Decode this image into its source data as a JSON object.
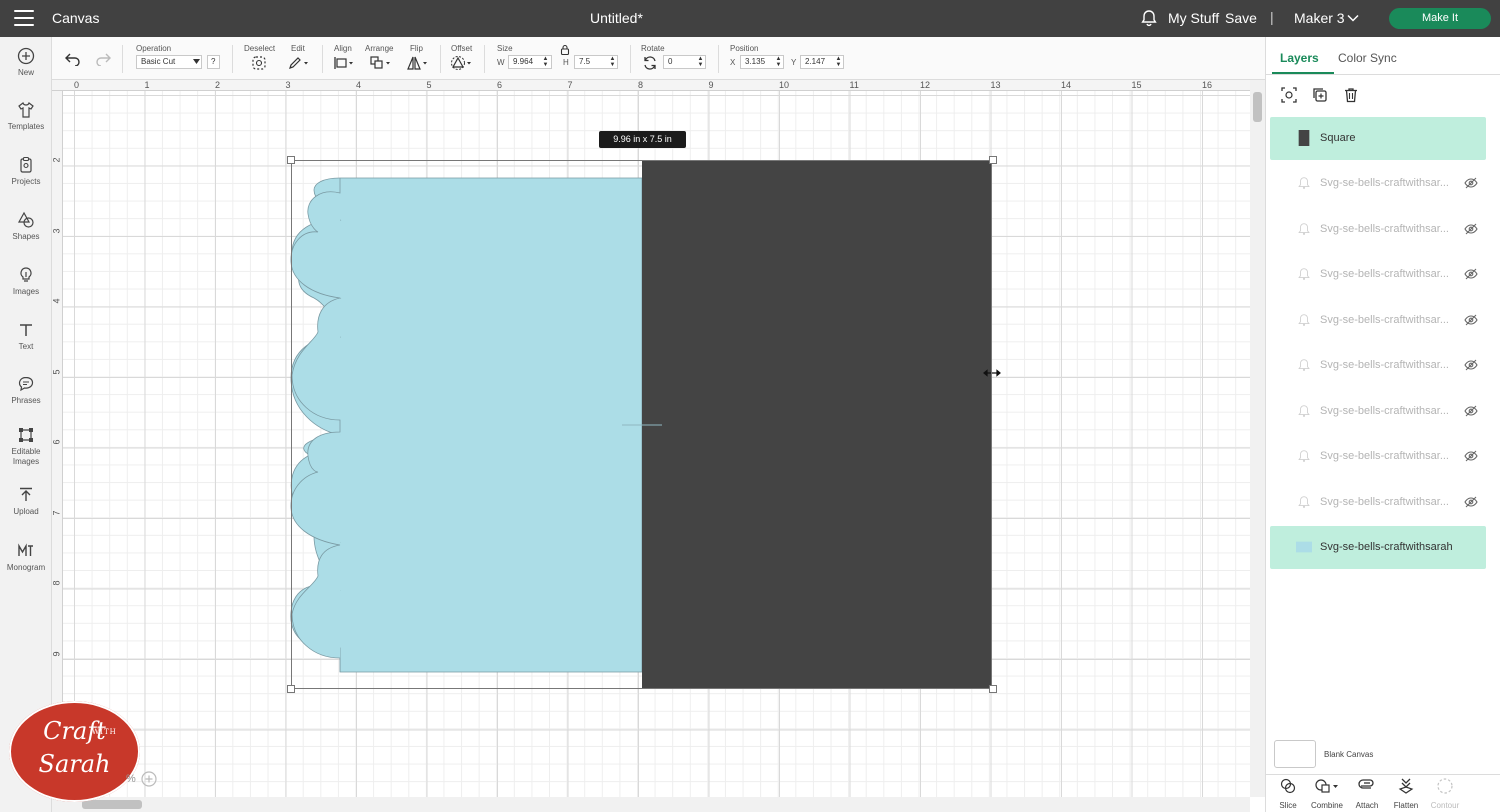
{
  "header": {
    "app_name": "Canvas",
    "doc_title": "Untitled*",
    "my_stuff": "My Stuff",
    "save": "Save",
    "separator": "|",
    "machine": "Maker 3",
    "make_it": "Make It"
  },
  "leftbar": {
    "items": [
      {
        "label": "New",
        "icon": "plus-circle-icon"
      },
      {
        "label": "Templates",
        "icon": "shirt-icon"
      },
      {
        "label": "Projects",
        "icon": "projects-icon"
      },
      {
        "label": "Shapes",
        "icon": "shapes-icon"
      },
      {
        "label": "Images",
        "icon": "lightbulb-icon"
      },
      {
        "label": "Text",
        "icon": "text-icon"
      },
      {
        "label": "Phrases",
        "icon": "speech-bubble-icon"
      },
      {
        "label": "Editable Images",
        "icon": "editable-images-icon"
      },
      {
        "label": "Upload",
        "icon": "upload-icon"
      },
      {
        "label": "Monogram",
        "icon": "monogram-icon"
      }
    ]
  },
  "toolbar": {
    "operation_label": "Operation",
    "operation_value": "Basic Cut",
    "help": "?",
    "deselect_label": "Deselect",
    "edit_label": "Edit",
    "align_label": "Align",
    "arrange_label": "Arrange",
    "flip_label": "Flip",
    "offset_label": "Offset",
    "size_label": "Size",
    "w_label": "W",
    "w_value": "9.964",
    "h_label": "H",
    "h_value": "7.5",
    "rotate_label": "Rotate",
    "rotate_value": "0",
    "position_label": "Position",
    "x_label": "X",
    "x_value": "3.135",
    "y_label": "Y",
    "y_value": "2.147"
  },
  "canvas": {
    "ruler_x": [
      "0",
      "1",
      "2",
      "3",
      "4",
      "5",
      "6",
      "7",
      "8",
      "9",
      "10",
      "11",
      "12",
      "13",
      "14",
      "15",
      "16"
    ],
    "ruler_y": [
      "2",
      "3",
      "4",
      "5",
      "6",
      "7",
      "8",
      "9"
    ],
    "size_tooltip": "9.96  in x 7.5  in",
    "design_colors": {
      "card": "#acdde7",
      "square": "#444444"
    }
  },
  "watermark": {
    "line1": "Craft",
    "with": "WITH",
    "line2": "Sarah"
  },
  "zoom": {
    "label": "%"
  },
  "rightpanel": {
    "tabs": {
      "layers": "Layers",
      "color_sync": "Color Sync"
    },
    "layers": [
      {
        "name": "Square",
        "selected": true,
        "hidden": false,
        "color": "#444444"
      },
      {
        "name": "Svg-se-bells-craftwithsar...",
        "selected": false,
        "hidden": true
      },
      {
        "name": "Svg-se-bells-craftwithsar...",
        "selected": false,
        "hidden": true
      },
      {
        "name": "Svg-se-bells-craftwithsar...",
        "selected": false,
        "hidden": true
      },
      {
        "name": "Svg-se-bells-craftwithsar...",
        "selected": false,
        "hidden": true
      },
      {
        "name": "Svg-se-bells-craftwithsar...",
        "selected": false,
        "hidden": true
      },
      {
        "name": "Svg-se-bells-craftwithsar...",
        "selected": false,
        "hidden": true
      },
      {
        "name": "Svg-se-bells-craftwithsar...",
        "selected": false,
        "hidden": true
      },
      {
        "name": "Svg-se-bells-craftwithsar...",
        "selected": false,
        "hidden": true
      },
      {
        "name": "Svg-se-bells-craftwithsarah",
        "selected": true,
        "hidden": false,
        "color": "#acdde7"
      }
    ],
    "blank_canvas": "Blank Canvas",
    "bottom_tools": [
      {
        "label": "Slice",
        "enabled": true
      },
      {
        "label": "Combine",
        "enabled": true
      },
      {
        "label": "Attach",
        "enabled": true
      },
      {
        "label": "Flatten",
        "enabled": true
      },
      {
        "label": "Contour",
        "enabled": false
      }
    ],
    "accent": "#1a8a5a"
  }
}
